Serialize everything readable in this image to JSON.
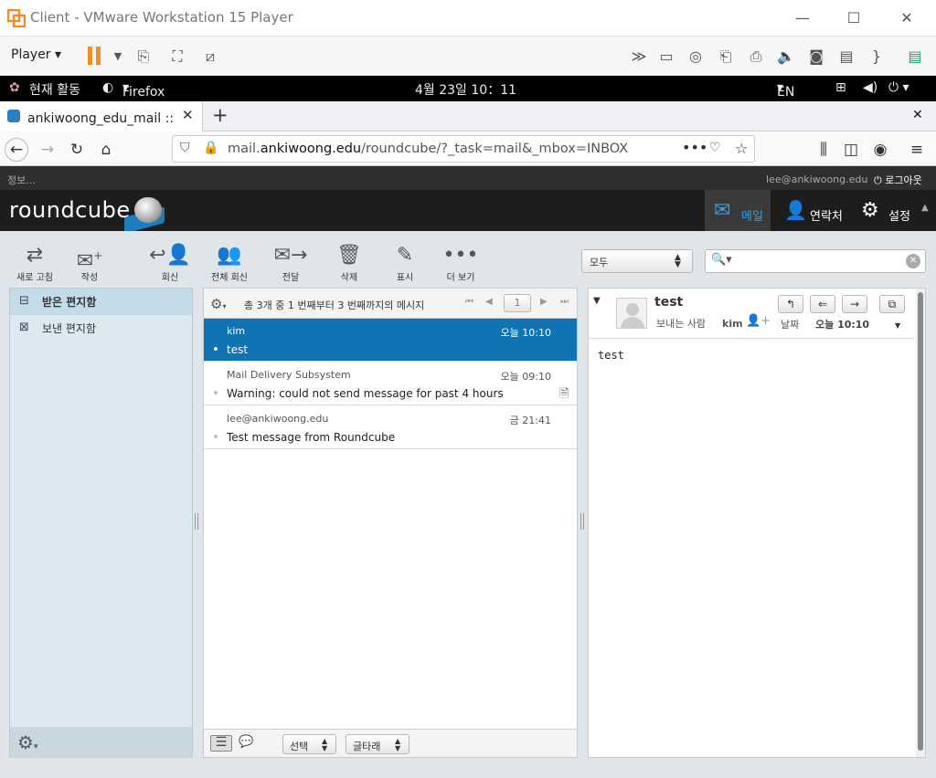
{
  "vm": {
    "title": "Client - VMware Workstation 15 Player",
    "player_label": "Player",
    "colors": {
      "accent": "#f08c2a"
    }
  },
  "gnome": {
    "activities": "현재 활동",
    "app": "Firefox",
    "clock": "4월 23일  10：11",
    "lang": "EN"
  },
  "firefox": {
    "tab_title": "ankiwoong_edu_mail :: 받",
    "url_prefix": "mail.",
    "url_domain": "ankiwoong.edu",
    "url_path": "/roundcube/?_task=mail&_mbox=INBOX"
  },
  "rc": {
    "info_label": "정보...",
    "user": "lee@ankiwoong.edu",
    "logout": "로그아웃",
    "logo": "roundcube",
    "nav": {
      "mail": "메일",
      "contacts": "연락처",
      "settings": "설정"
    },
    "toolbar": {
      "refresh": "새로 고침",
      "compose": "작성",
      "reply": "회신",
      "reply_all": "전체 회신",
      "forward": "전달",
      "delete": "삭제",
      "mark": "표시",
      "more": "더 보기"
    },
    "search_scope": "모두",
    "folders": [
      {
        "label": "받은 편지함",
        "selected": true
      },
      {
        "label": "보낸 편지함",
        "selected": false
      }
    ],
    "list": {
      "count_text": "총 3개 중 1 번째부터 3 번째까지의 메시지",
      "page": "1",
      "messages": [
        {
          "from": "kim",
          "date": "오늘 10:10",
          "subject": "test",
          "selected": true
        },
        {
          "from": "Mail Delivery Subsystem",
          "date": "오늘 09:10",
          "subject": "Warning: could not send message for past 4 hours",
          "selected": false
        },
        {
          "from": "lee@ankiwoong.edu",
          "date": "금 21:41",
          "subject": "Test message from Roundcube",
          "selected": false
        }
      ],
      "select_label": "선택",
      "thread_label": "글타래"
    },
    "preview": {
      "subject": "test",
      "sender_label": "보내는 사람",
      "sender": "kim",
      "date_label": "날짜",
      "date": "오늘 10:10",
      "body": "test"
    }
  }
}
